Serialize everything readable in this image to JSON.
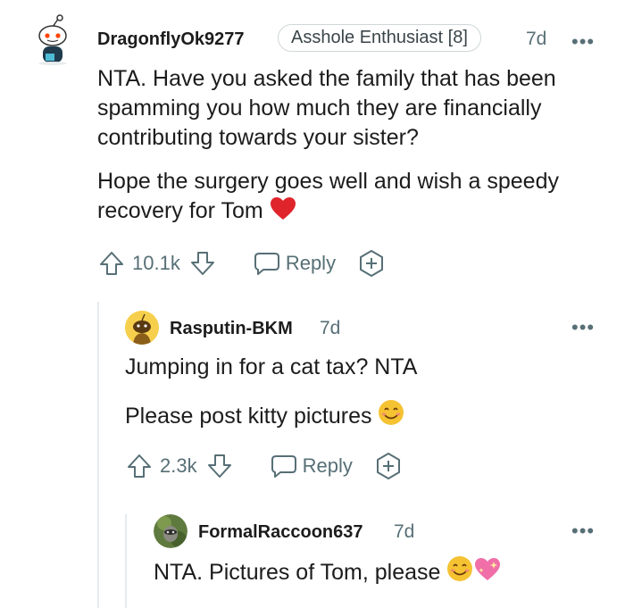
{
  "comments": [
    {
      "username": "DragonflyOk9277",
      "flair": "Asshole Enthusiast [8]",
      "age": "7d",
      "more": "•••",
      "paragraphs": [
        "NTA. Have you asked the family that has been spamming you how much they are financially contributing towards your sister?",
        "Hope the surgery goes well and wish a speedy recovery for Tom"
      ],
      "score": "10.1k",
      "reply_label": "Reply"
    },
    {
      "username": "Rasputin-BKM",
      "age": "7d",
      "more": "•••",
      "paragraphs": [
        "Jumping in for a cat tax? NTA",
        "Please post kitty pictures"
      ],
      "score": "2.3k",
      "reply_label": "Reply"
    },
    {
      "username": "FormalRaccoon637",
      "age": "7d",
      "more": "•••",
      "paragraphs": [
        "NTA. Pictures of Tom, please"
      ]
    }
  ],
  "icons": {
    "emoji_heart": "red-heart-emoji",
    "emoji_smile": "smiling-face-emoji",
    "emoji_sparkle_heart": "sparkling-heart-emoji"
  },
  "colors": {
    "meta_gray": "#576f76",
    "thread_line": "#e5ebee",
    "heart_red": "#e0242b",
    "smile_yellow": "#f5c232",
    "sparkle_pink": "#f06fa8"
  }
}
